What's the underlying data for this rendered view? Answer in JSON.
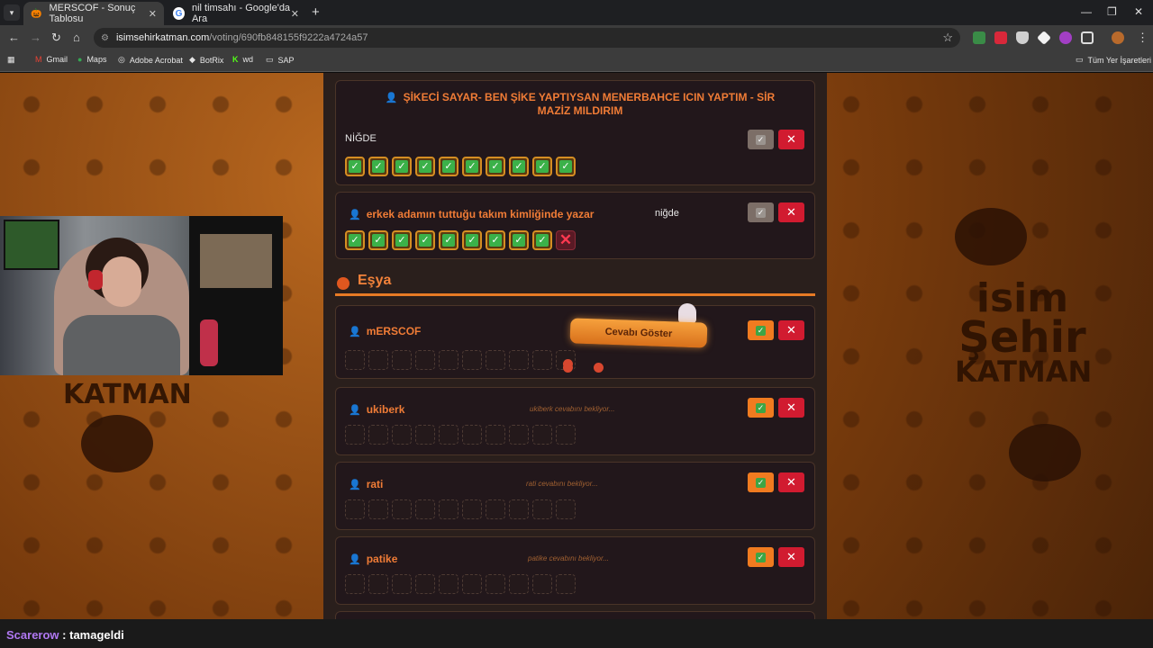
{
  "browser": {
    "tabs": [
      {
        "label": "MERSCOF - Sonuç Tablosu",
        "active": true
      },
      {
        "label": "nil timsahı - Google'da Ara",
        "active": false
      }
    ],
    "url_host": "isimsehirkatman.com",
    "url_path": "/voting/690fb848155f9222a4724a57",
    "bookmarks": [
      "Gmail",
      "Maps",
      "Adobe Acrobat",
      "BotRix",
      "wd",
      "SAP"
    ],
    "all_bookmarks": "Tüm Yer İşaretleri"
  },
  "cards": [
    {
      "player": "ŞİKECİ SAYAR- BEN ŞİKE YAPTIYSAN MENERBAHCE ICIN YAPTIM - SİR MAZİZ MILDIRIM",
      "answer": "NİĞDE",
      "votes": [
        "yes",
        "yes",
        "yes",
        "yes",
        "yes",
        "yes",
        "yes",
        "yes",
        "yes",
        "yes"
      ]
    },
    {
      "player": "erkek adamın tuttuğu takım kimliğinde yazar",
      "answer": "niğde",
      "votes": [
        "yes",
        "yes",
        "yes",
        "yes",
        "yes",
        "yes",
        "yes",
        "yes",
        "yes",
        "no"
      ]
    }
  ],
  "section_title": "Eşya",
  "eşya_cards": [
    {
      "player": "mERSCOF",
      "status": "",
      "reveal": "Cevabı Göster"
    },
    {
      "player": "ukiberk",
      "status": "ukiberk cevabını bekliyor..."
    },
    {
      "player": "rati",
      "status": "rati cevabını bekliyor..."
    },
    {
      "player": "patike",
      "status": "patike cevabını bekliyor..."
    }
  ],
  "deco": {
    "l1": "isim",
    "l2": "Şehir",
    "l3": "KATMAN",
    "left": "KATMAN"
  },
  "chat": {
    "user": "Scarerow",
    "message": ": tamageldi"
  }
}
